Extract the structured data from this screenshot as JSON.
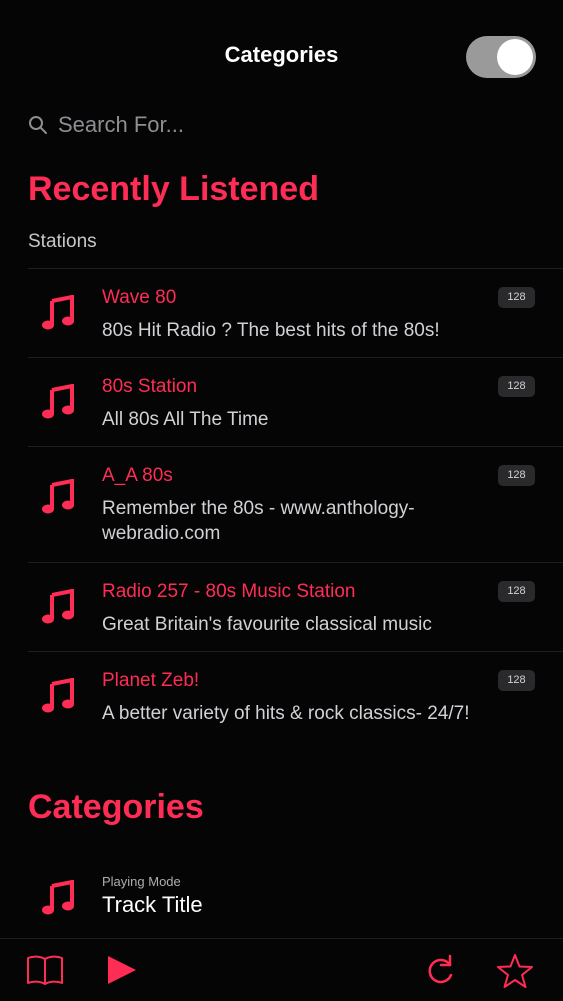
{
  "header": {
    "title": "Categories",
    "toggle_on": true
  },
  "search": {
    "placeholder": "Search For..."
  },
  "recent": {
    "title": "Recently Listened",
    "sublabel": "Stations",
    "stations": [
      {
        "name": "Wave 80",
        "desc": "80s Hit Radio ? The best hits of the 80s!",
        "bitrate": "128"
      },
      {
        "name": "80s Station",
        "desc": "All 80s All The Time",
        "bitrate": "128"
      },
      {
        "name": "A_A 80s",
        "desc": "Remember the 80s - www.anthology-webradio.com",
        "bitrate": "128"
      },
      {
        "name": "Radio 257 - 80s Music Station",
        "desc": "Great Britain's favourite classical music",
        "bitrate": "128"
      },
      {
        "name": "Planet Zeb!",
        "desc": "A better variety of hits & rock classics- 24/7!",
        "bitrate": "128"
      }
    ]
  },
  "categories": {
    "title": "Categories",
    "item": {
      "subtitle": "Playing Mode",
      "title": "Track Title"
    }
  },
  "tabbar": {
    "icons": [
      "book-icon",
      "play-icon",
      "refresh-icon",
      "star-icon"
    ]
  },
  "colors": {
    "accent": "#ff2d55",
    "background": "#050505",
    "toggle_track": "#9a9a9a"
  }
}
